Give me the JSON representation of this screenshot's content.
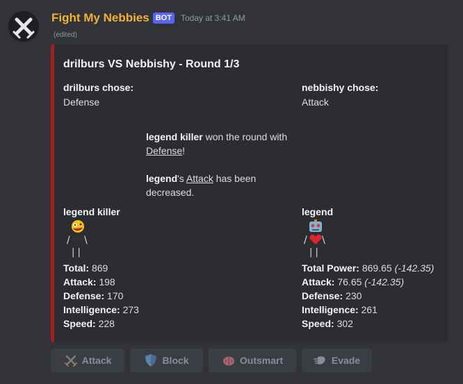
{
  "message": {
    "author": "Fight My Nebbies",
    "bot_tag": "BOT",
    "timestamp": "Today at 3:41 AM",
    "edited": "(edited)"
  },
  "embed": {
    "accent_color": "#a61f1f",
    "title": "drilburs VS Nebbishy - Round 1/3",
    "left_choice": {
      "label": "drilburs chose:",
      "value": "Defense"
    },
    "right_choice": {
      "label": "nebbishy chose:",
      "value": "Attack"
    },
    "result": {
      "winner": "legend killer",
      "won_text": " won the round with",
      "won_stat": "Defense",
      "won_end": "!",
      "loser": "legend",
      "loser_possessive": "'s ",
      "lost_stat": "Attack",
      "lost_text": " has been",
      "lost_text2": "decreased."
    },
    "left_fighter": {
      "name": "legend killer",
      "head_icon": "zany-face-icon",
      "stats": [
        {
          "label": "Total:",
          "value": "869"
        },
        {
          "label": "Attack:",
          "value": "198"
        },
        {
          "label": "Defense:",
          "value": "170"
        },
        {
          "label": "Intelligence:",
          "value": "273"
        },
        {
          "label": "Speed:",
          "value": "228"
        }
      ]
    },
    "right_fighter": {
      "name": "legend",
      "head_icon": "robot-face-icon",
      "body_icon": "red-heart-icon",
      "stats": [
        {
          "label": "Total Power:",
          "value": "869.65",
          "delta": "(-142.35)"
        },
        {
          "label": "Attack:",
          "value": "76.65",
          "delta": "(-142.35)"
        },
        {
          "label": "Defense:",
          "value": "230"
        },
        {
          "label": "Intelligence:",
          "value": "261"
        },
        {
          "label": "Speed:",
          "value": "302"
        }
      ]
    }
  },
  "buttons": [
    {
      "label": "Attack",
      "icon": "crossed-swords-icon"
    },
    {
      "label": "Block",
      "icon": "shield-icon"
    },
    {
      "label": "Outsmart",
      "icon": "brain-icon"
    },
    {
      "label": "Evade",
      "icon": "dash-icon"
    }
  ]
}
